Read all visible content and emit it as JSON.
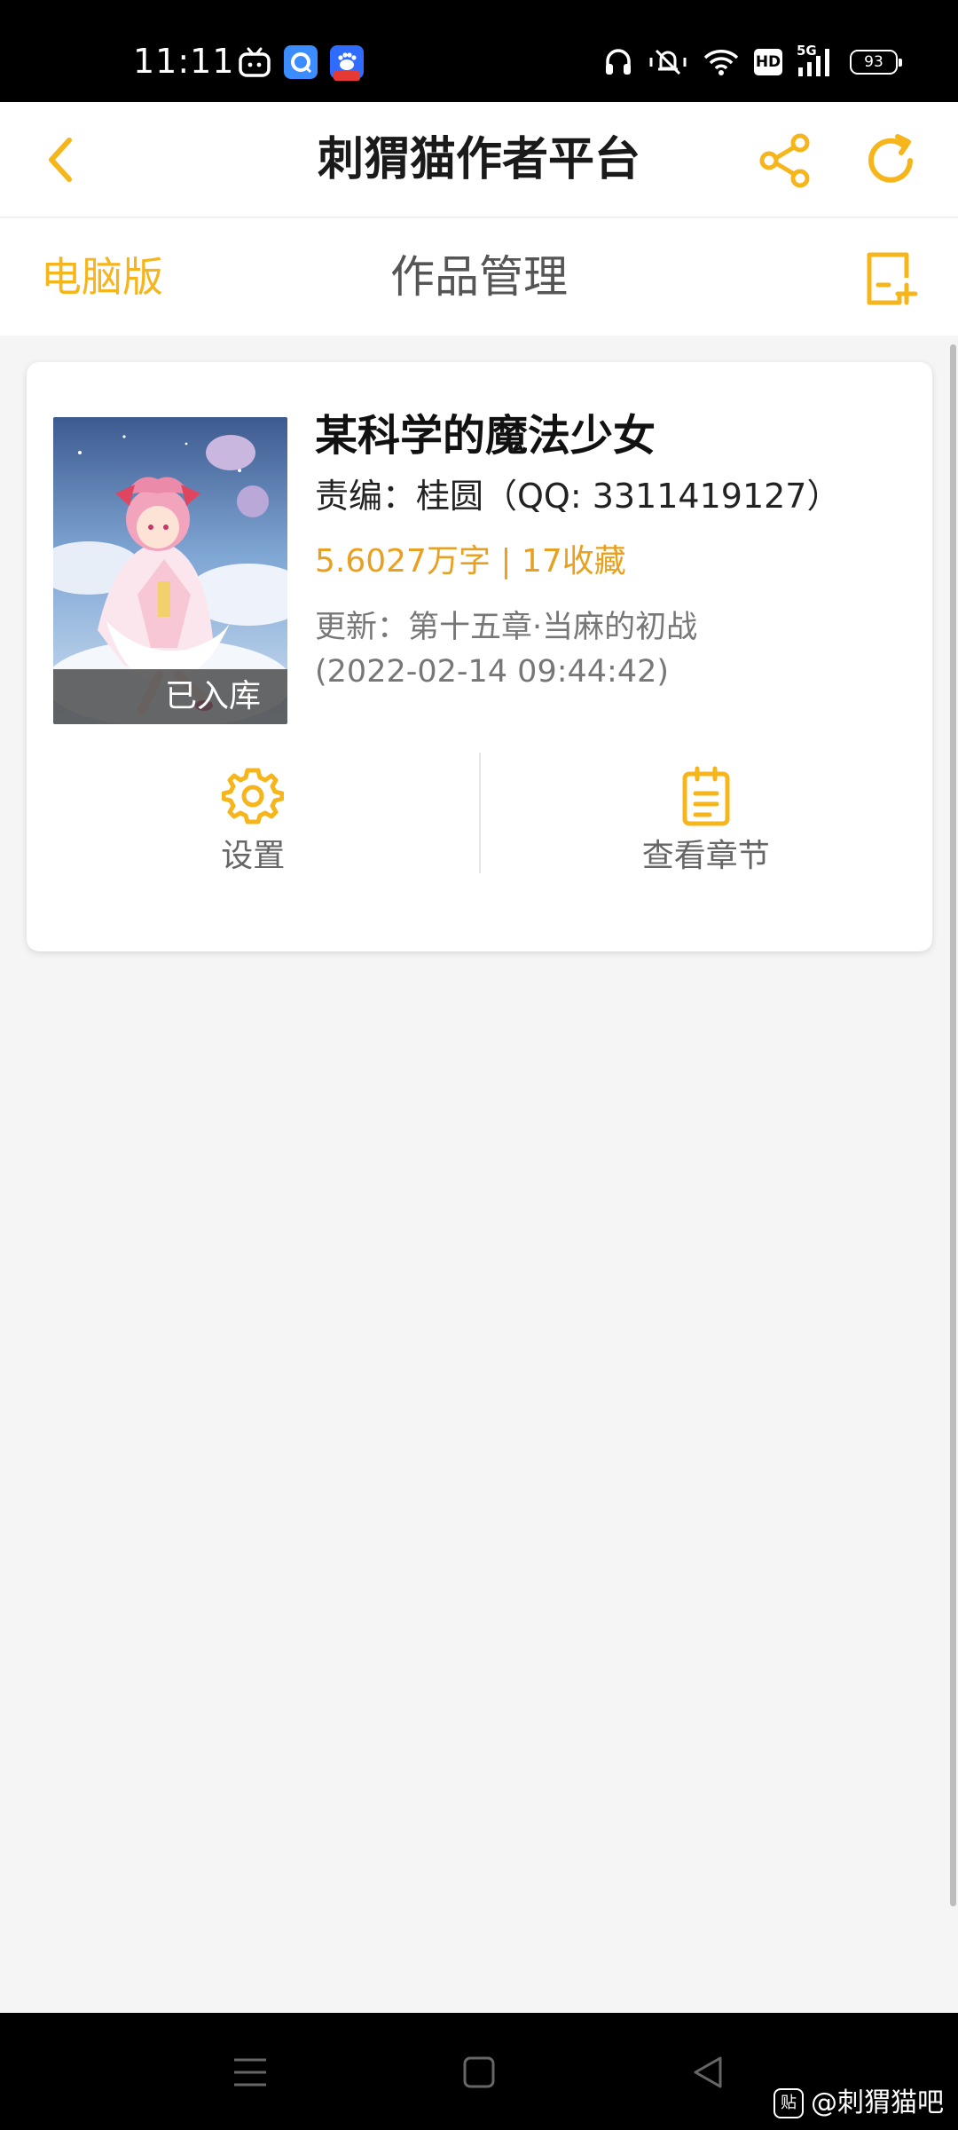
{
  "status_bar": {
    "time": "11:11",
    "network": "5G",
    "hd_label": "HD",
    "battery": "93",
    "icons": [
      "tv-icon",
      "browser-icon",
      "baidu-icon",
      "headphones-icon",
      "vibrate-mute-icon",
      "wifi-icon",
      "hd-icon",
      "signal-icon",
      "battery-icon"
    ]
  },
  "header": {
    "title": "刺猬猫作者平台",
    "icons": [
      "back-icon",
      "share-icon",
      "refresh-icon"
    ]
  },
  "sub_header": {
    "desktop_link": "电脑版",
    "title": "作品管理",
    "new_icon": "new-work-icon"
  },
  "work": {
    "title": "某科学的魔法少女",
    "editor": "责编：桂圆（QQ: 3311419127）",
    "stats": "5.6027万字 | 17收藏",
    "update_line1": "更新：第十五章·当麻的初战",
    "update_line2": "(2022-02-14 09:44:42)",
    "cover_badge": "已入库",
    "actions": {
      "settings": "设置",
      "chapters": "查看章节"
    }
  },
  "watermark": {
    "logo": "贴",
    "text": "@刺猬猫吧"
  },
  "colors": {
    "accent": "#f5b51b",
    "stats": "#e8a020",
    "bar": "#000000",
    "page_bg": "#f5f5f5"
  }
}
